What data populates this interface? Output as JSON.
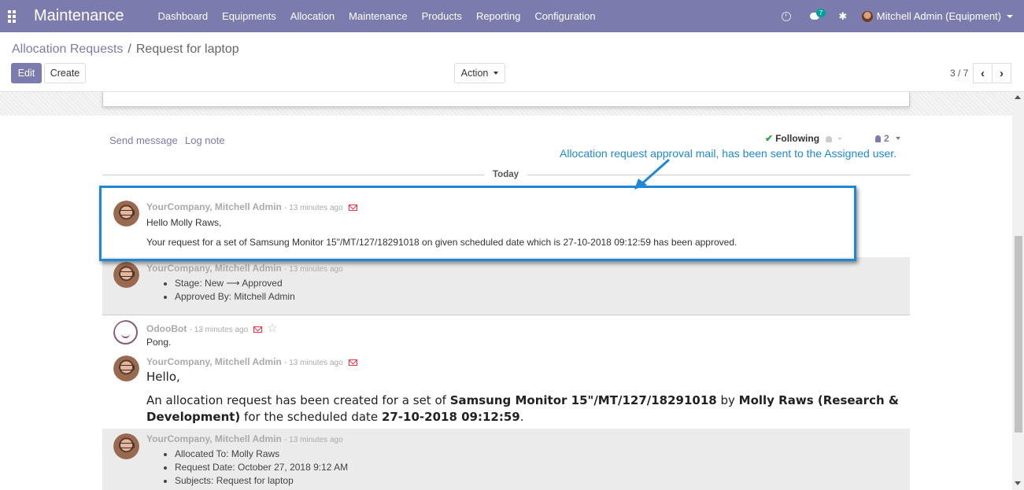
{
  "app": {
    "title": "Maintenance"
  },
  "menu": [
    "Dashboard",
    "Equipments",
    "Allocation",
    "Maintenance",
    "Products",
    "Reporting",
    "Configuration"
  ],
  "systray": {
    "chat_count": "7",
    "user_name": "Mitchell Admin (Equipment)"
  },
  "breadcrumb": {
    "parent": "Allocation Requests",
    "separator": "/",
    "current": "Request for laptop"
  },
  "buttons": {
    "edit": "Edit",
    "create": "Create",
    "action": "Action"
  },
  "pager": {
    "value": "3 / 7"
  },
  "chatter": {
    "send_message": "Send message",
    "log_note": "Log note",
    "following": "Following",
    "followers_count": "2",
    "today": "Today"
  },
  "annotation": "Allocation request approval mail, has been sent to the Assigned user.",
  "messages": [
    {
      "author": "YourCompany, Mitchell Admin",
      "time": "- 13 minutes ago",
      "line1": "Hello Molly Raws,",
      "line2": "Your request for a set of Samsung Monitor 15\"/MT/127/18291018 on given scheduled date which is 27-10-2018 09:12:59 has been approved."
    },
    {
      "author": "YourCompany, Mitchell Admin",
      "time": "- 13 minutes ago",
      "bullets": [
        "Stage: New ⟶ Approved",
        "Approved By: Mitchell Admin"
      ]
    },
    {
      "author": "OdooBot",
      "time": "- 13 minutes ago",
      "line1": "Pong."
    },
    {
      "author": "YourCompany, Mitchell Admin",
      "time": "- 13 minutes ago",
      "greeting": "Hello,",
      "text_a": "An allocation request has been created for a set of ",
      "bold_a": "Samsung Monitor 15\"/MT/127/18291018",
      "text_b": " by ",
      "bold_b": "Molly Raws (Research & Development)",
      "text_c": " for the scheduled date ",
      "bold_c": "27-10-2018 09:12:59",
      "text_d": "."
    },
    {
      "author": "YourCompany, Mitchell Admin",
      "time": "- 13 minutes ago",
      "bullets": [
        "Allocated To: Molly Raws",
        "Request Date: October 27, 2018 9:12 AM",
        "Subjects: Request for laptop"
      ]
    }
  ],
  "colors": {
    "brand": "#7c7bad",
    "annotation": "#1e88d6",
    "note_bg": "#ebebeb"
  },
  "icons": [
    "apps-icon",
    "clock-icon",
    "chat-icon",
    "bug-icon",
    "check-icon",
    "bell-icon",
    "person-icon",
    "envelope-icon",
    "star-icon",
    "chevron-left-icon",
    "chevron-right-icon"
  ]
}
